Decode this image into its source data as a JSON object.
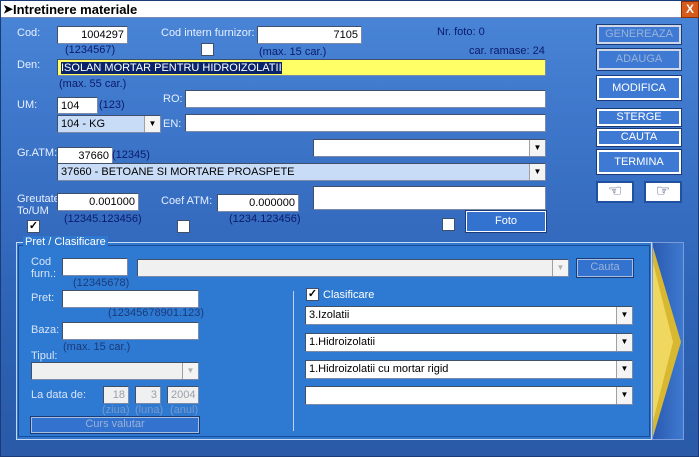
{
  "window": {
    "title": "Intretinere materiale",
    "close_label": "X"
  },
  "cod": {
    "label": "Cod:",
    "value": "1004297",
    "hint": "(1234567)"
  },
  "cod_intern": {
    "label": "Cod intern furnizor:",
    "value": "7105",
    "hint": "(max. 15 car.)"
  },
  "nr_foto": "Nr. foto: 0",
  "car_ramase": "car. ramase: 24",
  "den": {
    "label": "Den:",
    "value": "ISOLAN MORTAR PENTRU HIDROIZOLATII",
    "hint": "(max. 55 car.)"
  },
  "um": {
    "label": "UM:",
    "value": "104",
    "hint": "(123)",
    "selected": "104 - KG"
  },
  "ro": {
    "label": "RO:",
    "value": ""
  },
  "en": {
    "label": "EN:",
    "value": ""
  },
  "gratm": {
    "label": "Gr.ATM:",
    "value": "37660",
    "hint": "(12345)",
    "selected": "37660 - BETOANE SI MORTARE PROASPETE"
  },
  "greutate": {
    "label_line1": "Greutate",
    "label_line2": "To/UM",
    "value": "0.001000",
    "hint": "(12345.123456)"
  },
  "coef": {
    "label": "Coef ATM:",
    "value": "0.000000",
    "hint": "(1234.123456)"
  },
  "buttons": {
    "genereaza": "GENEREAZA",
    "adauga": "ADAUGA",
    "modifica": "MODIFICA",
    "sterge": "STERGE",
    "cauta": "CAUTA",
    "termina": "TERMINA",
    "foto": "Foto"
  },
  "pret_section": {
    "legend": "Pret / Clasificare",
    "cod_furn_label_1": "Cod",
    "cod_furn_label_2": "furn.:",
    "cod_furn_hint": "(12345678)",
    "cauta_button": "Cauta",
    "pret_label": "Pret:",
    "pret_hint": "(12345678901.123)",
    "baza_label": "Baza:",
    "baza_hint": "(max. 15 car.)",
    "tipul_label": "Tipul:",
    "la_data_label": "La data de:",
    "day": "18",
    "month": "3",
    "year": "2004",
    "day_hint": "ziua",
    "month_hint": "luna",
    "year_hint": "anul",
    "curs_button": "Curs valutar",
    "clasificare_label": "Clasificare",
    "clasificare_checked": true,
    "level1": "3.Izolatii",
    "level2": "1.Hidroizolatii",
    "level3": "1.Hidroizolatii cu mortar rigid",
    "level4": ""
  }
}
